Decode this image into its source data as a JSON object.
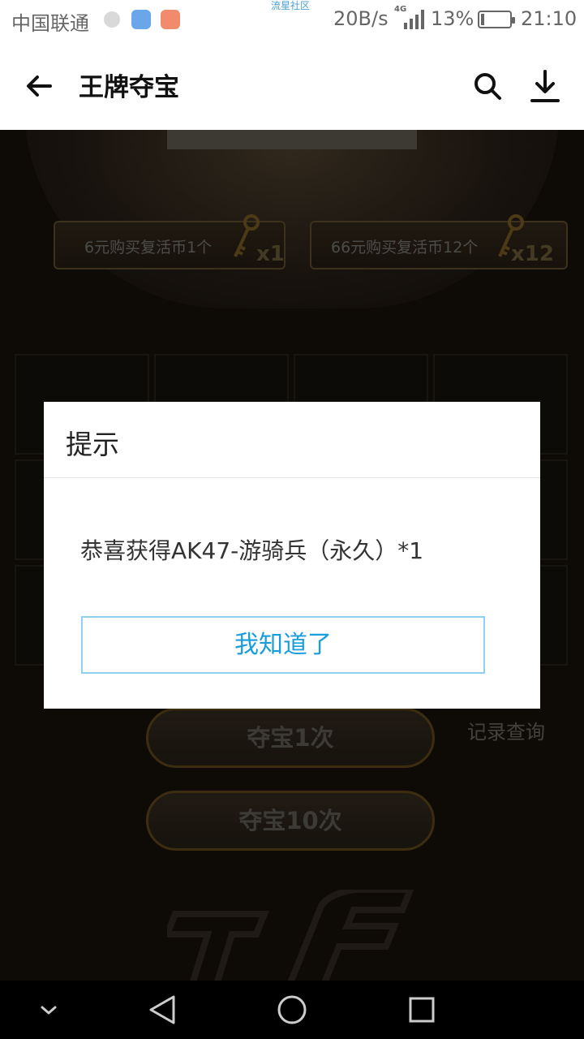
{
  "status_bar": {
    "carrier": "中国联通",
    "watermark": "流星社区",
    "speed": "20B/s",
    "network": "4G",
    "battery_percent": "13%",
    "battery_level": 0.13,
    "time": "21:10",
    "icons": [
      "gear-icon",
      "map-pin-icon",
      "app-icon",
      "signal-icon",
      "battery-icon"
    ]
  },
  "header": {
    "title": "王牌夺宝",
    "back_icon": "arrow-left-icon",
    "search_icon": "search-icon",
    "download_icon": "download-icon"
  },
  "game": {
    "buy_options": [
      {
        "label": "6元购买复活币1个",
        "multiplier": "x1"
      },
      {
        "label": "66元购买复活币12个",
        "multiplier": "x12"
      }
    ],
    "actions": {
      "draw_once": "夺宝1次",
      "draw_ten": "夺宝10次",
      "records": "记录查询"
    }
  },
  "dialog": {
    "title": "提示",
    "message": "恭喜获得AK47-游骑兵（永久）*1",
    "confirm_label": "我知道了"
  },
  "nav_bar": {
    "icons": [
      "chevron-down-icon",
      "back-triangle-icon",
      "home-circle-icon",
      "recent-square-icon"
    ]
  },
  "colors": {
    "accent": "#1a9ddc",
    "dialog_button_border": "#8fd0ee",
    "game_gold": "#6e5220"
  }
}
